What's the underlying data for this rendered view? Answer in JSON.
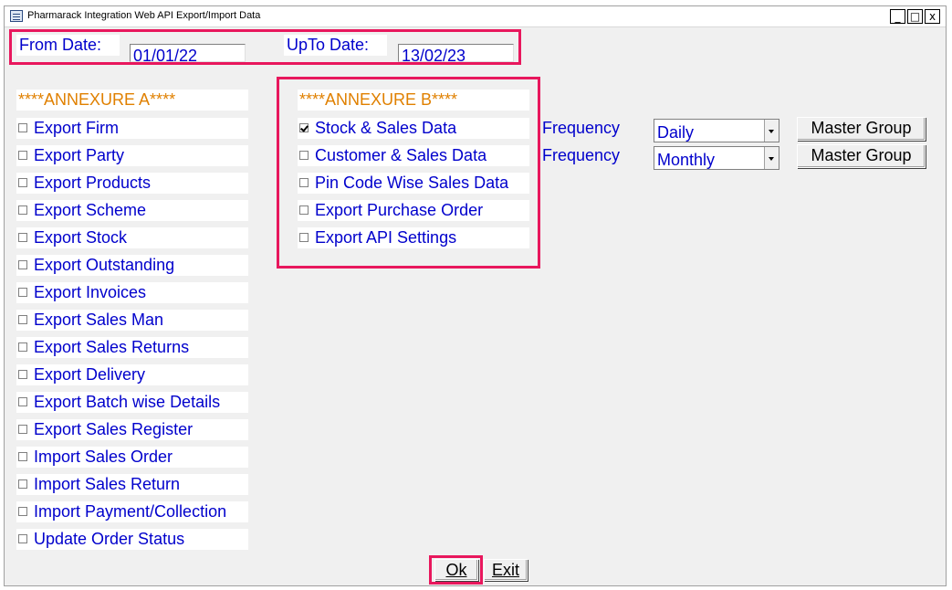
{
  "window": {
    "title": "Pharmarack Integration Web API Export/Import Data",
    "minimize": "_",
    "maximize": "□",
    "close": "x"
  },
  "dates": {
    "from_label": "From Date:",
    "from_value": "01/01/22",
    "upto_label": "UpTo Date:",
    "upto_value": "13/02/23"
  },
  "annexure_a": {
    "heading": "****ANNEXURE A****",
    "items": [
      {
        "label": "Export Firm",
        "checked": false
      },
      {
        "label": "Export Party",
        "checked": false
      },
      {
        "label": "Export Products",
        "checked": false
      },
      {
        "label": "Export Scheme",
        "checked": false
      },
      {
        "label": "Export Stock",
        "checked": false
      },
      {
        "label": "Export Outstanding",
        "checked": false
      },
      {
        "label": "Export Invoices",
        "checked": false
      },
      {
        "label": "Export Sales Man",
        "checked": false
      },
      {
        "label": "Export Sales Returns",
        "checked": false
      },
      {
        "label": "Export Delivery",
        "checked": false
      },
      {
        "label": "Export Batch wise Details",
        "checked": false
      },
      {
        "label": "Export Sales Register",
        "checked": false
      },
      {
        "label": "Import Sales Order",
        "checked": false
      },
      {
        "label": "Import Sales Return",
        "checked": false
      },
      {
        "label": "Import Payment/Collection",
        "checked": false
      },
      {
        "label": "Update Order Status",
        "checked": false
      }
    ]
  },
  "annexure_b": {
    "heading": "****ANNEXURE B****",
    "items": [
      {
        "label": "Stock & Sales Data",
        "checked": true
      },
      {
        "label": "Customer & Sales Data",
        "checked": false
      },
      {
        "label": "Pin Code Wise Sales Data",
        "checked": false
      },
      {
        "label": "Export Purchase Order",
        "checked": false
      },
      {
        "label": "Export API Settings",
        "checked": false
      }
    ]
  },
  "frequency": [
    {
      "label": "Frequency",
      "value": "Daily",
      "button": "Master Group"
    },
    {
      "label": "Frequency",
      "value": "Monthly",
      "button": "Master Group"
    }
  ],
  "buttons": {
    "ok": "Ok",
    "exit": "Exit"
  },
  "colors": {
    "label_text": "#0000cc",
    "annexure_heading": "#e08000",
    "highlight": "#e8175d"
  }
}
